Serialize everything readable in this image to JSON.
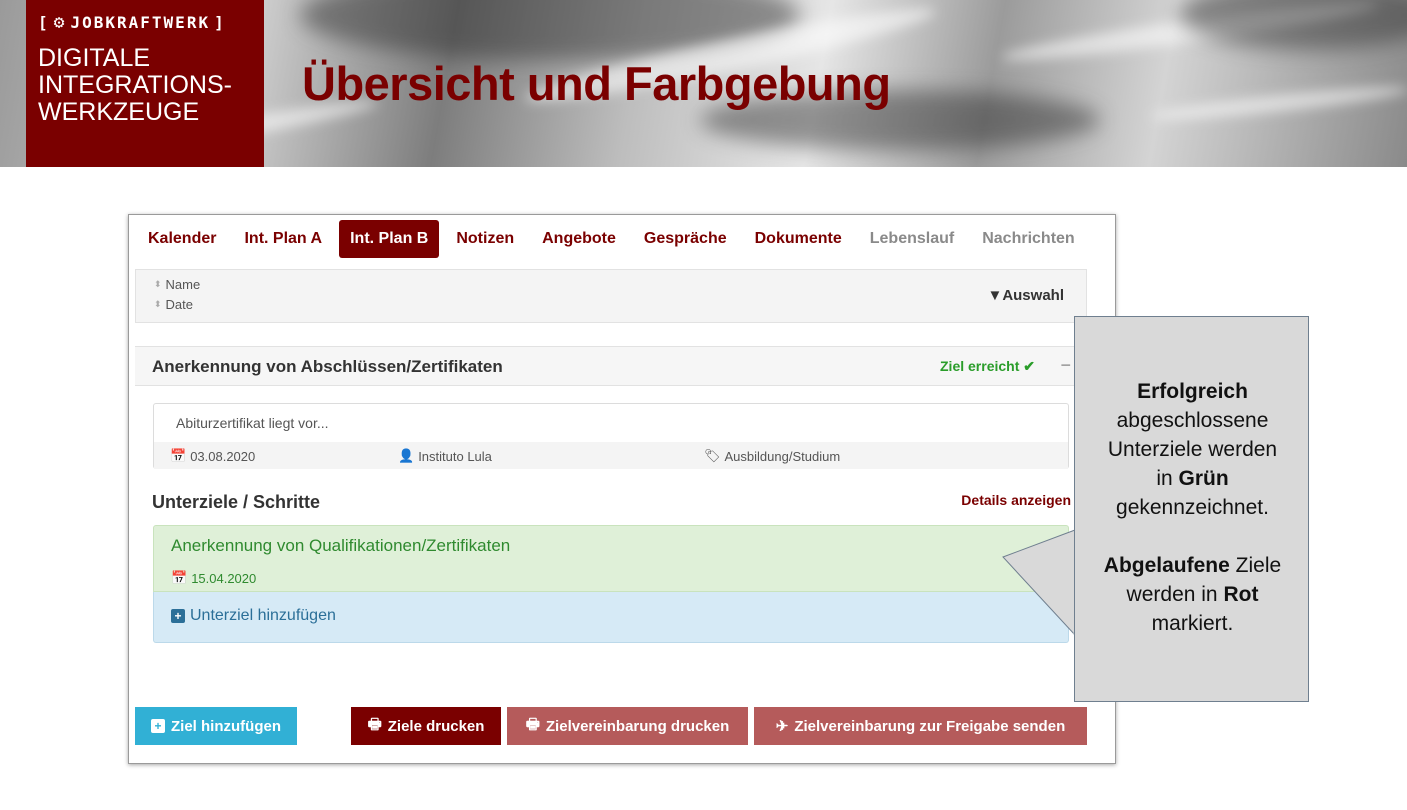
{
  "header": {
    "logo_text": "JobKraftwerk",
    "logo_sub": [
      "DIGITALE",
      "INTEGRATIONS-",
      "WERKZEUGE"
    ],
    "title": "Übersicht und Farbgebung"
  },
  "tabs": [
    {
      "label": "Kalender",
      "state": "normal"
    },
    {
      "label": "Int. Plan A",
      "state": "normal"
    },
    {
      "label": "Int. Plan B",
      "state": "active"
    },
    {
      "label": "Notizen",
      "state": "normal"
    },
    {
      "label": "Angebote",
      "state": "normal"
    },
    {
      "label": "Gespräche",
      "state": "normal"
    },
    {
      "label": "Dokumente",
      "state": "normal"
    },
    {
      "label": "Lebenslauf",
      "state": "muted"
    },
    {
      "label": "Nachrichten",
      "state": "muted"
    }
  ],
  "sort": {
    "name_label": "Name",
    "date_label": "Date",
    "filter_label": "Auswahl"
  },
  "goal": {
    "title": "Anerkennung von Abschlüssen/Zertifikaten",
    "status": "Ziel erreicht",
    "description": "Abiturzertifikat liegt vor...",
    "date": "03.08.2020",
    "institution": "Instituto Lula",
    "category": "Ausbildung/Studium"
  },
  "subgoals": {
    "heading": "Unterziele / Schritte",
    "details_link": "Details anzeigen",
    "item_title": "Anerkennung von Qualifikationen/Zertifikaten",
    "item_date": "15.04.2020",
    "add_label": "Unterziel hinzufügen"
  },
  "buttons": {
    "add_goal": "Ziel hinzufügen",
    "print_goals": "Ziele drucken",
    "print_agreement": "Zielvereinbarung drucken",
    "send_agreement": "Zielvereinbarung zur Freigabe senden"
  },
  "callout": {
    "p1_bold": "Erfolgreich",
    "p1_a": "abgeschlossene",
    "p1_b": "Unterziele werden",
    "p1_c": "in",
    "p1_green": "Grün",
    "p1_d": "gekennzeichnet.",
    "p2_bold": "Abgelaufene",
    "p2_a": "Ziele",
    "p2_b": "werden in",
    "p2_red": "Rot",
    "p2_c": "markiert."
  },
  "colors": {
    "brand": "#7a0000",
    "success": "#2a9d2a",
    "info": "#31b0d5",
    "muted_button": "#b55b5b"
  }
}
